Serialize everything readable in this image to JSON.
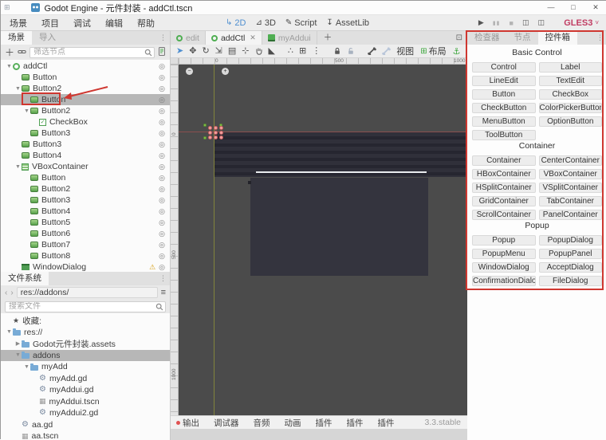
{
  "window": {
    "title": "Godot Engine - 元件封装 - addCtl.tscn",
    "minimize": "—",
    "maximize": "□",
    "close": "✕"
  },
  "menubar": {
    "items": [
      "场景",
      "项目",
      "调试",
      "编辑",
      "帮助"
    ],
    "modes": [
      {
        "name": "mode-2d",
        "label": "2D",
        "icon": "↳",
        "active": true
      },
      {
        "name": "mode-3d",
        "label": "3D",
        "icon": "⊿",
        "active": false
      },
      {
        "name": "mode-script",
        "label": "Script",
        "icon": "✎",
        "active": false
      },
      {
        "name": "mode-assetlib",
        "label": "AssetLib",
        "icon": "↧",
        "active": false
      }
    ],
    "run": [
      {
        "name": "play-button",
        "glyph": "▶",
        "enabled": true
      },
      {
        "name": "pause-button",
        "glyph": "▮▮",
        "enabled": false
      },
      {
        "name": "stop-button",
        "glyph": "■",
        "enabled": false
      },
      {
        "name": "play-scene-button",
        "glyph": "◫",
        "enabled": true
      },
      {
        "name": "play-custom-scene-button",
        "glyph": "◫",
        "enabled": true
      }
    ],
    "renderer": "GLES3"
  },
  "scene_dock": {
    "tabs": [
      {
        "label": "场景",
        "active": true
      },
      {
        "label": "导入",
        "active": false
      }
    ],
    "filter_placeholder": "筛选节点",
    "tree": [
      {
        "label": "addCtl",
        "icon": "control-root",
        "indent": 0,
        "expand": "open"
      },
      {
        "label": "Button",
        "icon": "button",
        "indent": 1
      },
      {
        "label": "Button2",
        "icon": "button",
        "indent": 1,
        "expand": "open"
      },
      {
        "label": "Button",
        "icon": "button",
        "indent": 2,
        "selected": true,
        "annotated": true
      },
      {
        "label": "Button2",
        "icon": "button",
        "indent": 2,
        "expand": "open"
      },
      {
        "label": "CheckBox",
        "icon": "checkbox",
        "indent": 3
      },
      {
        "label": "Button3",
        "icon": "button",
        "indent": 2
      },
      {
        "label": "Button3",
        "icon": "button",
        "indent": 1
      },
      {
        "label": "Button4",
        "icon": "button",
        "indent": 1
      },
      {
        "label": "VBoxContainer",
        "icon": "vbox",
        "indent": 1,
        "expand": "open"
      },
      {
        "label": "Button",
        "icon": "button",
        "indent": 2
      },
      {
        "label": "Button2",
        "icon": "button",
        "indent": 2
      },
      {
        "label": "Button3",
        "icon": "button",
        "indent": 2
      },
      {
        "label": "Button4",
        "icon": "button",
        "indent": 2
      },
      {
        "label": "Button5",
        "icon": "button",
        "indent": 2
      },
      {
        "label": "Button6",
        "icon": "button",
        "indent": 2
      },
      {
        "label": "Button7",
        "icon": "button",
        "indent": 2
      },
      {
        "label": "Button8",
        "icon": "button",
        "indent": 2
      },
      {
        "label": "WindowDialog",
        "icon": "window",
        "indent": 1,
        "warning": true
      }
    ]
  },
  "filesystem_dock": {
    "tab": "文件系统",
    "path": "res://addons/",
    "search_placeholder": "搜索文件",
    "favorites_label": "收藏:",
    "tree": [
      {
        "label": "收藏:",
        "icon": "star",
        "indent": 0
      },
      {
        "label": "res://",
        "icon": "folder",
        "indent": 0,
        "expand": "open"
      },
      {
        "label": "Godot元件封装.assets",
        "icon": "folder",
        "indent": 1,
        "expand": "closed"
      },
      {
        "label": "addons",
        "icon": "folder",
        "indent": 1,
        "expand": "open",
        "selected": true
      },
      {
        "label": "myAdd",
        "icon": "folder",
        "indent": 2,
        "expand": "open"
      },
      {
        "label": "myAdd.gd",
        "icon": "gear",
        "indent": 3
      },
      {
        "label": "myAddui.gd",
        "icon": "gear",
        "indent": 3
      },
      {
        "label": "myAddui.tscn",
        "icon": "scene",
        "indent": 3
      },
      {
        "label": "myAddui2.gd",
        "icon": "gear",
        "indent": 3
      },
      {
        "label": "aa.gd",
        "icon": "gear",
        "indent": 1
      },
      {
        "label": "aa.tscn",
        "icon": "scene",
        "indent": 1
      }
    ]
  },
  "canvas": {
    "tabs": [
      {
        "label": "edit",
        "icon": "scene",
        "active": false
      },
      {
        "label": "addCtl",
        "icon": "scene",
        "active": true,
        "closable": true
      },
      {
        "label": "myAddui",
        "icon": "scene-script",
        "active": false
      }
    ],
    "toolbar_groups": [
      [
        "select",
        "move",
        "rotate",
        "scale",
        "list-select",
        "pivot",
        "pan",
        "ruler"
      ],
      [
        "smart-snap",
        "grid-snap",
        "snap-options"
      ],
      [
        "lock",
        "unlock"
      ],
      [
        "skeleton",
        "skeleton-options"
      ]
    ],
    "view_menu": "视图",
    "layout_menu": "布局",
    "ruler_x_labels": [
      "0",
      "500",
      "1000"
    ],
    "ruler_y_labels": [
      "0",
      "500",
      "1000"
    ]
  },
  "bottom_bar": {
    "items": [
      "输出",
      "调试器",
      "音频",
      "动画",
      "插件",
      "插件",
      "插件"
    ],
    "version": "3.3.stable"
  },
  "control_box": {
    "tabs": [
      {
        "label": "检查器",
        "active": false
      },
      {
        "label": "节点",
        "active": false
      },
      {
        "label": "控件箱",
        "active": true
      }
    ],
    "sections": [
      {
        "title": "Basic Control",
        "buttons": [
          "Control",
          "Label",
          "LineEdit",
          "TextEdit",
          "Button",
          "CheckBox",
          "CheckButton",
          "ColorPickerButton",
          "MenuButton",
          "OptionButton",
          "ToolButton"
        ]
      },
      {
        "title": "Container",
        "buttons": [
          "Container",
          "CenterContainer",
          "HBoxContainer",
          "VBoxContainer",
          "HSplitContainer",
          "VSplitContainer",
          "GridContainer",
          "TabContainer",
          "ScrollContainer",
          "PanelContainer"
        ]
      },
      {
        "title": "Popup",
        "buttons": [
          "Popup",
          "PopupDialog",
          "PopupMenu",
          "PopupPanel",
          "WindowDialog",
          "AcceptDialog",
          "ConfirmationDialog",
          "FileDialog"
        ]
      }
    ]
  },
  "colors": {
    "accent_blue": "#4f8fd0",
    "node_green": "#57a24b",
    "annotation_red": "#cf3730",
    "renderer_pink": "#c13d63",
    "folder_blue": "#78abd6",
    "canvas_gray": "#4b4b4b"
  }
}
